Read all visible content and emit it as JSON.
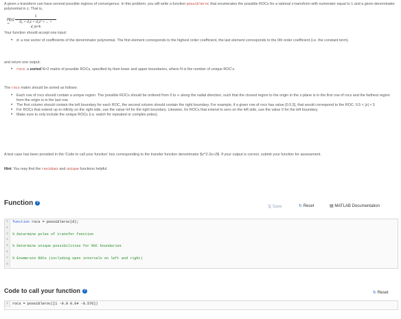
{
  "desc": {
    "p1a": "A given z-transform can have several possible regions of convergence. In this problem, you will write a function",
    "p1code": "possibleroc",
    "p1b": "that enumerates the possible ROCs for a rational z-transform with numerator equal to 1 and a given denominator polynomial in z. That is,",
    "formula": {
      "lhs": "H(z) =",
      "num": "1",
      "den": "d₀ + d₁z + d₂z² + ... + d_kz^k"
    },
    "inputs_heading": "Your function should accept one input:",
    "input_item": "d: a row vector of coefficients of the denominator polynomial. The first element corresponds to the highest order coefficient, the last element corresponds to the 0th order coefficient (i.e. the constant term).",
    "output_heading": "and return one output:",
    "output_code": "rocs",
    "output_label": ": a",
    "output_sorted": "sorted",
    "output_text": "N×2 matrix of possible ROCs, specified by their lower and upper boundaries, where N is the number of unique ROC's.",
    "sort_heading_pre": "The",
    "sort_heading_code": "rocs",
    "sort_heading_post": "matrix should be sorted as follows:",
    "rules": [
      "Each row of rocs should contain a unique region. The possible ROCs should be ordered from 0 to ∞ along the radial direction, such that the closest region to the origin in the z-plane is in the first row of rocs and the farthest region from the origin is in the last row.",
      "The first column should contain the left boundary for each ROC, the second column should contain the right boundary. For example, if a given row of rocs has value [0.5,5], that would correspond to the ROC: 0.5 < |z| < 5",
      "For ROCs that extend up to infinity on the right side, use the value Inf for the right boundary. Likewise, for ROCs that extend to zero on the left side, use the value 0 for the left boundary.",
      "Make sure to only include the unique ROCs (i.e. watch for repeated or complex poles)."
    ],
    "testcase": "A test case has been provided in the 'Code to call your function' box corresponding to the transfer function denominator $z^2-3z+2$. If your output is correct, submit your function for assessment.",
    "hint_label": "Hint",
    "hint_pre": ": You may find the",
    "hint_code1": "residuez",
    "hint_mid": "and",
    "hint_code2": "unique",
    "hint_post": "functions helpful."
  },
  "function_section": {
    "title": "Function",
    "help": "?",
    "save": "Save",
    "reset": "Reset",
    "docs": "MATLAB Documentation",
    "lines": [
      {
        "n": "1",
        "kw": "function",
        "code": " rocs = possibleroc(d);",
        "cm": ""
      },
      {
        "n": "2",
        "kw": "",
        "code": "",
        "cm": ""
      },
      {
        "n": "3",
        "kw": "",
        "code": "",
        "cm": "% Determine poles of transfer function"
      },
      {
        "n": "4",
        "kw": "",
        "code": "",
        "cm": ""
      },
      {
        "n": "5",
        "kw": "",
        "code": "",
        "cm": "% Determine unique possibilities for ROC boundaries"
      },
      {
        "n": "6",
        "kw": "",
        "code": "",
        "cm": ""
      },
      {
        "n": "7",
        "kw": "",
        "code": "",
        "cm": "% Enumerate ROCs (including open intervals on left and right)"
      },
      {
        "n": "8",
        "kw": "",
        "code": "",
        "cm": ""
      }
    ]
  },
  "call_section": {
    "title": "Code to call your function",
    "help": "?",
    "reset": "Reset",
    "lines": [
      {
        "n": "1",
        "code": "rocs = possibleroc([1 -0.9 0.64 -0.576])"
      }
    ]
  },
  "colors": {
    "accent": "#1565c0",
    "comment": "#228b22",
    "keyword": "#1a4fd0"
  },
  "icons": {
    "save": "save-icon",
    "reset": "reset-icon",
    "docs": "book-icon",
    "help": "help-icon"
  }
}
